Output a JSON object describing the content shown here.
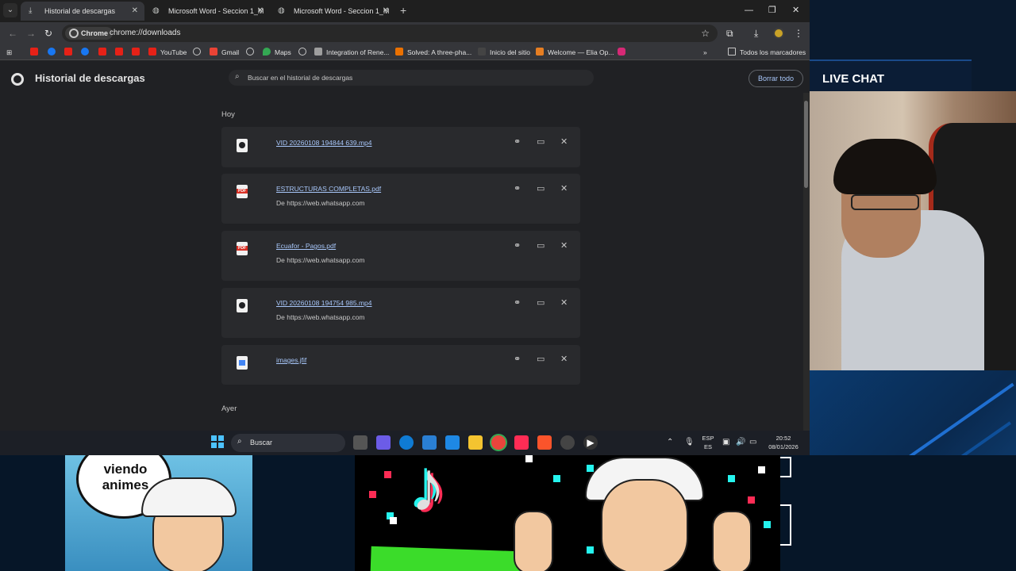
{
  "tabs": [
    {
      "label": "Historial de descargas",
      "active": true
    },
    {
      "label": "Microsoft Word - Seccion 1_M",
      "active": false
    },
    {
      "label": "Microsoft Word - Seccion 1_M",
      "active": false
    }
  ],
  "omnibox": {
    "chip": "Chrome",
    "url": "chrome://downloads"
  },
  "bookmarks": [
    {
      "label": "YouTube",
      "icon": "youtube-icon"
    },
    {
      "label": "Gmail",
      "icon": "gmail-icon"
    },
    {
      "label": "Maps",
      "icon": "maps-icon"
    },
    {
      "label": "Integration of Rene...",
      "icon": "globe-icon"
    },
    {
      "label": "Solved: A three-pha...",
      "icon": "chegg-icon"
    },
    {
      "label": "Inicio del sitio",
      "icon": "site-icon"
    },
    {
      "label": "Welcome — Elia Op...",
      "icon": "elia-icon"
    },
    {
      "label": "Todos los marcadores",
      "icon": "folder-icon"
    }
  ],
  "page": {
    "title": "Historial de descargas",
    "search_placeholder": "Buscar en el historial de descargas",
    "clear_all": "Borrar todo"
  },
  "groups": [
    {
      "date": "Hoy"
    },
    {
      "date": "Ayer"
    }
  ],
  "downloads": [
    {
      "filename": "VID 20260108 194844 639.mp4",
      "source": "",
      "type": "video"
    },
    {
      "filename": "ESTRUCTURAS COMPLETAS.pdf",
      "source": "De https://web.whatsapp.com",
      "type": "pdf"
    },
    {
      "filename": "Ecuafor - Pagos.pdf",
      "source": "De https://web.whatsapp.com",
      "type": "pdf"
    },
    {
      "filename": "VID 20260108 194754 985.mp4",
      "source": "De https://web.whatsapp.com",
      "type": "video"
    },
    {
      "filename": "images.jfif",
      "source": "",
      "type": "image"
    }
  ],
  "taskbar": {
    "search_label": "Buscar",
    "lang_top": "ESP",
    "lang_bottom": "ES",
    "time": "20:52",
    "date": "08/01/2026"
  },
  "overlay": {
    "live_chat": "LIVE CHAT",
    "thumb_text": "viendo animes"
  },
  "colors": {
    "accent_link": "#a8c7fa",
    "page_bg": "#202124",
    "card_bg": "#292a2d",
    "stream_blue": "#0b3a6e"
  }
}
